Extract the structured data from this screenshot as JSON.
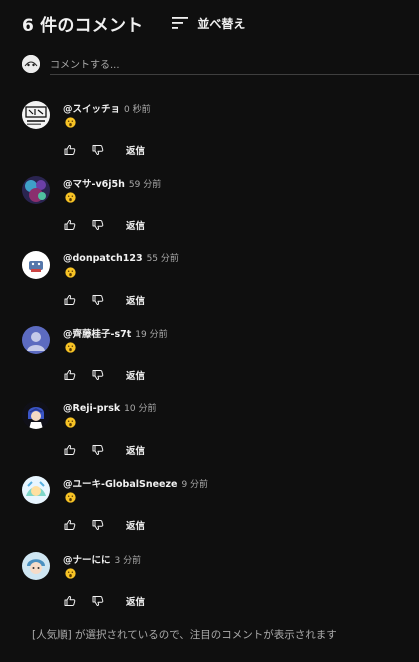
{
  "header": {
    "title": "6 件のコメント",
    "sort_label": "並べ替え"
  },
  "add_comment": {
    "placeholder": "コメントする..."
  },
  "reply_label": "返信",
  "comments": [
    {
      "author": "@スイッチョ",
      "time": "0 秒前",
      "text": "😮"
    },
    {
      "author": "@マサ-v6j5h",
      "time": "59 分前",
      "text": "😮"
    },
    {
      "author": "@donpatch123",
      "time": "55 分前",
      "text": "😮"
    },
    {
      "author": "@齊藤桂子-s7t",
      "time": "19 分前",
      "text": "😮"
    },
    {
      "author": "@Reji-prsk",
      "time": "10 分前",
      "text": "😮"
    },
    {
      "author": "@ユーキ-GlobalSneeze",
      "time": "9 分前",
      "text": "😮"
    },
    {
      "author": "@ナーにに",
      "time": "3 分前",
      "text": "😮"
    }
  ],
  "footer": {
    "note": "[人気順] が選択されているので、注目のコメントが表示されます"
  },
  "colors": {
    "background": "#0f0f0f",
    "text": "#f1f1f1",
    "secondary_text": "#aaaaaa",
    "emoji": "#f7c325"
  }
}
